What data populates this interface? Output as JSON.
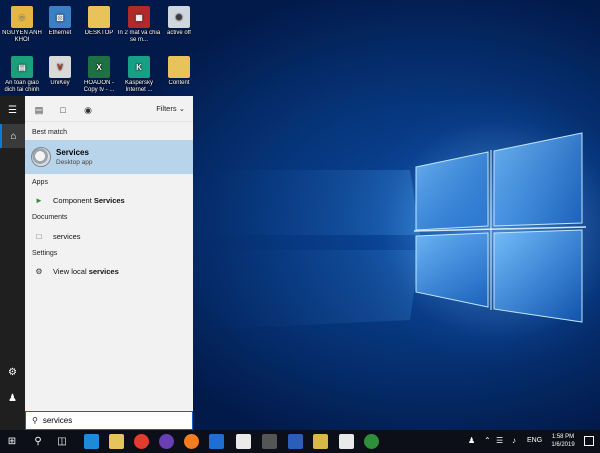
{
  "desktop": {
    "icons": [
      {
        "label": "NGUYEN ANH KHOI",
        "icon": "user-folder-icon",
        "color": "#e6b645"
      },
      {
        "label": "Ethernet",
        "icon": "network-icon",
        "color": "#3b7fc4"
      },
      {
        "label": "DESKTOP",
        "icon": "folder-icon",
        "color": "#e8c25a"
      },
      {
        "label": "In 2 mat va chia se m...",
        "icon": "pdf-document-icon",
        "color": "#b02a2a"
      },
      {
        "label": "active off",
        "icon": "shortcut-icon",
        "color": "#cfd6dd"
      },
      {
        "label": "An toan giao dich tai chinh",
        "icon": "shield-app-icon",
        "color": "#1aa07a"
      },
      {
        "label": "UniKey",
        "icon": "unikey-icon",
        "color": "#d9d9d9"
      },
      {
        "label": "HOADON - Copy tv - ...",
        "icon": "excel-file-icon",
        "color": "#1e7145"
      },
      {
        "label": "Kaspersky Internet ...",
        "icon": "kaspersky-icon",
        "color": "#16a085"
      },
      {
        "label": "Content",
        "icon": "folder-icon",
        "color": "#e8c25a"
      }
    ]
  },
  "start_panel": {
    "filters_label": "Filters",
    "sections": {
      "best_match": "Best match",
      "apps": "Apps",
      "documents": "Documents",
      "settings": "Settings"
    },
    "best_match": {
      "title": "Services",
      "subtitle": "Desktop app"
    },
    "apps": [
      {
        "prefix": "Component ",
        "bold": "Services"
      }
    ],
    "documents": [
      {
        "label": "services"
      }
    ],
    "settings": [
      {
        "prefix": "View local ",
        "bold": "services"
      }
    ]
  },
  "search": {
    "value": "services"
  },
  "taskbar": {
    "tray_language": "ENG",
    "time": "1:58 PM",
    "date": "1/6/2019"
  }
}
